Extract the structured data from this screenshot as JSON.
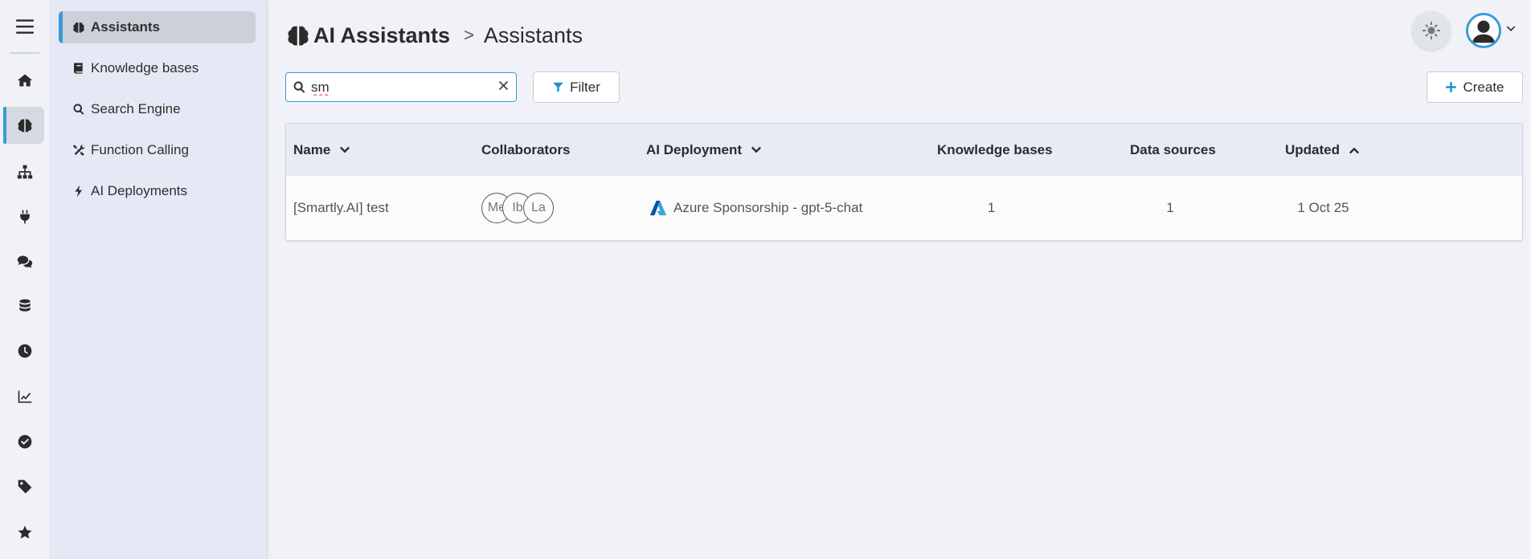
{
  "breadcrumb": {
    "section": "AI Assistants",
    "separator": ">",
    "page": "Assistants"
  },
  "sidebar": {
    "items": [
      {
        "label": "Assistants",
        "icon": "brain-icon",
        "active": true
      },
      {
        "label": "Knowledge bases",
        "icon": "book-icon"
      },
      {
        "label": "Search Engine",
        "icon": "search-icon"
      },
      {
        "label": "Function Calling",
        "icon": "tools-icon"
      },
      {
        "label": "AI Deployments",
        "icon": "bolt-icon"
      }
    ]
  },
  "rail": {
    "icons": [
      "menu-icon",
      "home-icon",
      "brain-icon",
      "sitemap-icon",
      "plug-icon",
      "comments-icon",
      "database-icon",
      "clock-icon",
      "chart-line-icon",
      "check-circle-icon",
      "tag-icon",
      "star-icon"
    ],
    "active": "brain-icon"
  },
  "toolbar": {
    "search_value": "sm",
    "filter_label": "Filter",
    "create_label": "Create"
  },
  "table": {
    "headers": {
      "name": "Name",
      "collaborators": "Collaborators",
      "deployment": "AI Deployment",
      "knowledge_bases": "Knowledge bases",
      "data_sources": "Data sources",
      "updated": "Updated"
    },
    "rows": [
      {
        "name": "[Smartly.AI] test",
        "collaborators": [
          "Me",
          "Ib",
          "La"
        ],
        "deployment": "Azure Sponsorship - gpt-5-chat",
        "knowledge_bases": "1",
        "data_sources": "1",
        "updated": "1 Oct 25"
      }
    ]
  },
  "colors": {
    "accent": "#3a9bd8",
    "button_icon": "#1a8fd8",
    "azure_dark": "#0a4f9c",
    "azure_light": "#36a9e1"
  }
}
